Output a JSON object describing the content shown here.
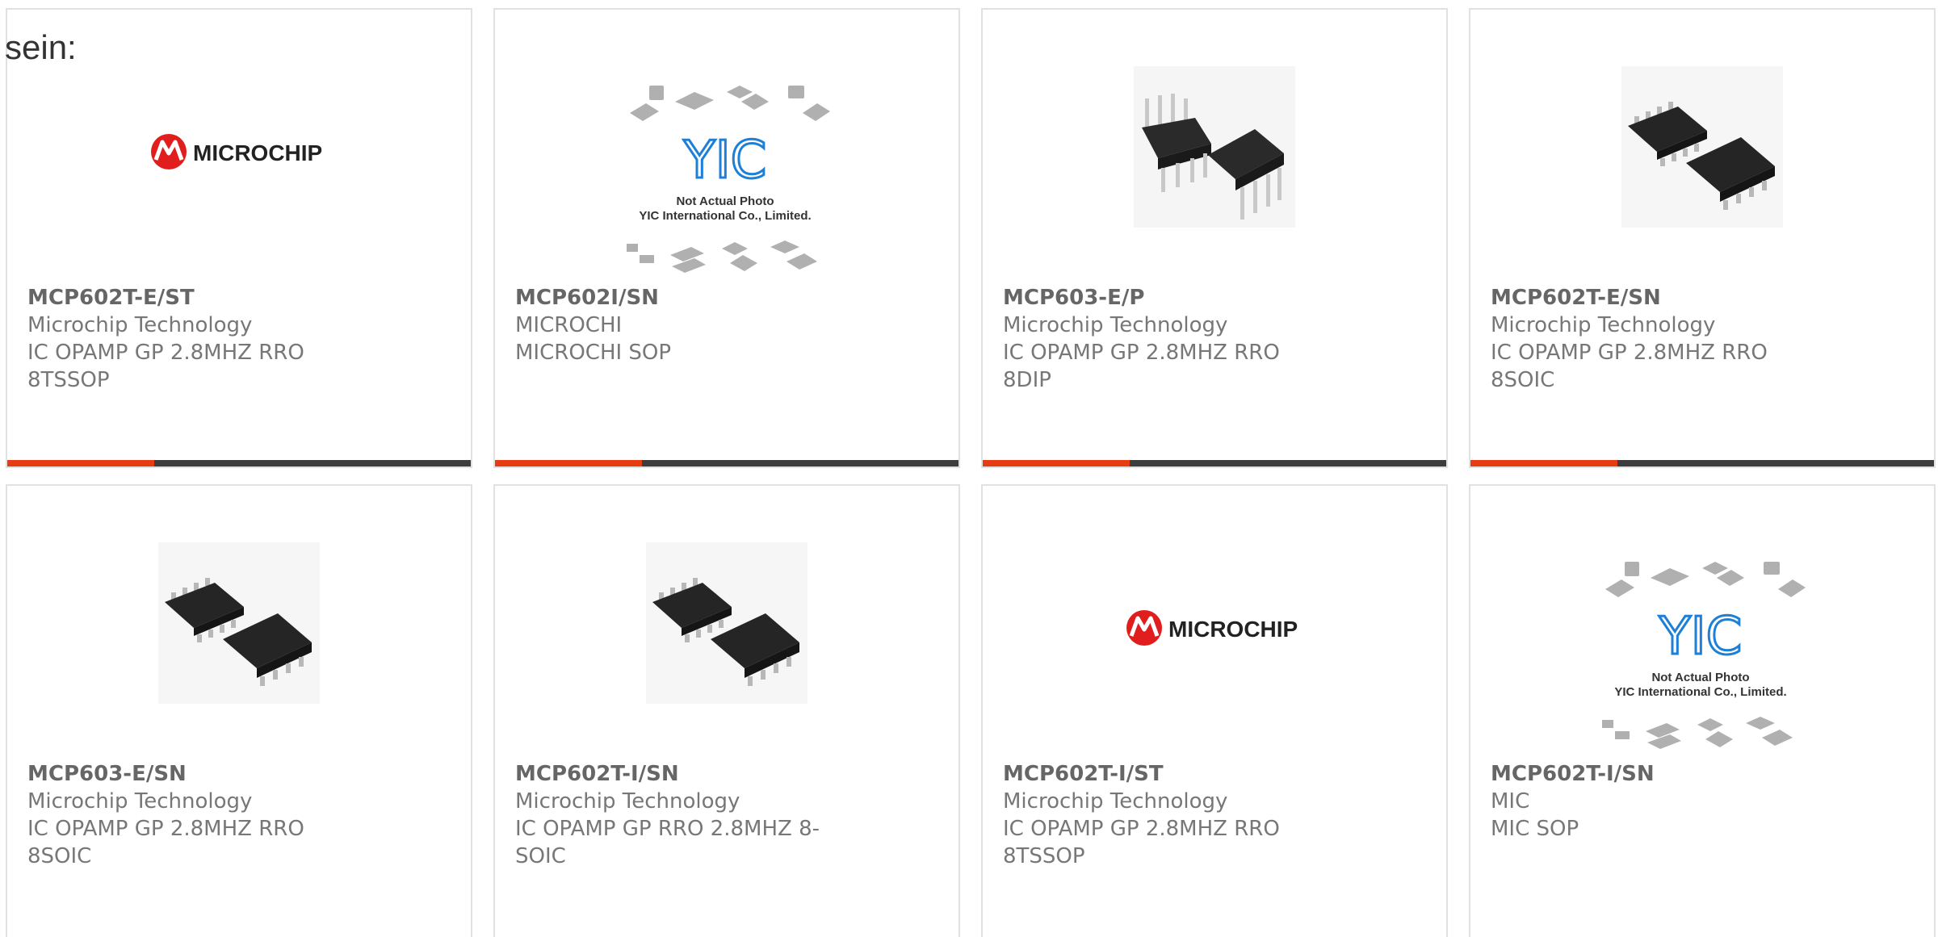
{
  "lead_text": "sein:",
  "colors": {
    "accent": "#e63c12",
    "bar": "#3d3d3d",
    "microchip_red": "#e01e1e",
    "yic_blue": "#1e7fd6"
  },
  "products": [
    {
      "part_number": "MCP602T-E/ST",
      "manufacturer": "Microchip Technology",
      "description": "IC OPAMP GP 2.8MHZ RRO 8TSSOP",
      "image": "microchip-logo"
    },
    {
      "part_number": "MCP602I/SN",
      "manufacturer": "MICROCHI",
      "description": "MICROCHI SOP",
      "image": "yic-placeholder",
      "placeholder_line1": "Not Actual Photo",
      "placeholder_line2": "YIC International Co., Limited.",
      "placeholder_logo": "YIC"
    },
    {
      "part_number": "MCP603-E/P",
      "manufacturer": "Microchip Technology",
      "description": "IC OPAMP GP 2.8MHZ RRO 8DIP",
      "image": "dip-chip-photo"
    },
    {
      "part_number": "MCP602T-E/SN",
      "manufacturer": "Microchip Technology",
      "description": "IC OPAMP GP 2.8MHZ RRO 8SOIC",
      "image": "soic-chip-photo"
    },
    {
      "part_number": "MCP603-E/SN",
      "manufacturer": "Microchip Technology",
      "description": "IC OPAMP GP 2.8MHZ RRO 8SOIC",
      "image": "soic-chip-photo"
    },
    {
      "part_number": "MCP602T-I/SN",
      "manufacturer": "Microchip Technology",
      "description": "IC OPAMP GP RRO 2.8MHZ 8-SOIC",
      "image": "soic-chip-photo"
    },
    {
      "part_number": "MCP602T-I/ST",
      "manufacturer": "Microchip Technology",
      "description": "IC OPAMP GP 2.8MHZ RRO 8TSSOP",
      "image": "microchip-logo"
    },
    {
      "part_number": "MCP602T-I/SN",
      "manufacturer": "MIC",
      "description": "MIC SOP",
      "image": "yic-placeholder",
      "placeholder_line1": "Not Actual Photo",
      "placeholder_line2": "YIC International Co., Limited.",
      "placeholder_logo": "YIC"
    }
  ],
  "brand": {
    "microchip_wordmark": "MICROCHIP"
  }
}
